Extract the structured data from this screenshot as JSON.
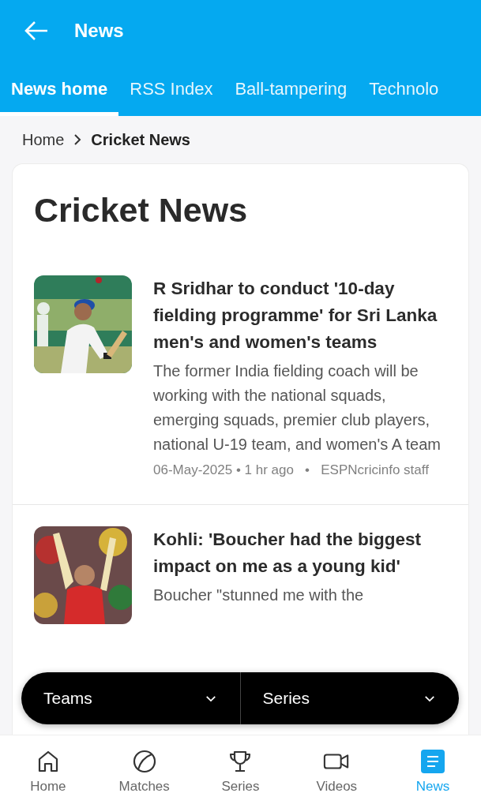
{
  "app_bar": {
    "title": "News"
  },
  "tabs": [
    {
      "label": "News home",
      "selected": true
    },
    {
      "label": "RSS Index",
      "selected": false
    },
    {
      "label": "Ball-tampering",
      "selected": false
    },
    {
      "label": "Technolo",
      "selected": false
    }
  ],
  "breadcrumb": {
    "items": [
      "Home",
      "Cricket News"
    ]
  },
  "heading": "Cricket News",
  "articles": [
    {
      "title": "R Sridhar to conduct '10-day fielding programme' for Sri Lanka men's and women's teams",
      "summary": "The former India fielding coach will be working with the national squads, emerging squads, premier club players, national U-19 team, and women's A team",
      "meta": "06-May-2025 • 1 hr ago   •   ESPNcricinfo staff"
    },
    {
      "title": "Kohli: 'Boucher had the biggest impact on me as a young kid'",
      "summary": "Boucher \"stunned me with the"
    }
  ],
  "filters": [
    {
      "label": "Teams"
    },
    {
      "label": "Series"
    }
  ],
  "bottom_nav": [
    {
      "label": "Home",
      "kind": "home",
      "selected": false
    },
    {
      "label": "Matches",
      "kind": "ball",
      "selected": false
    },
    {
      "label": "Series",
      "kind": "trophy",
      "selected": false
    },
    {
      "label": "Videos",
      "kind": "video",
      "selected": false
    },
    {
      "label": "News",
      "kind": "news",
      "selected": true
    }
  ]
}
